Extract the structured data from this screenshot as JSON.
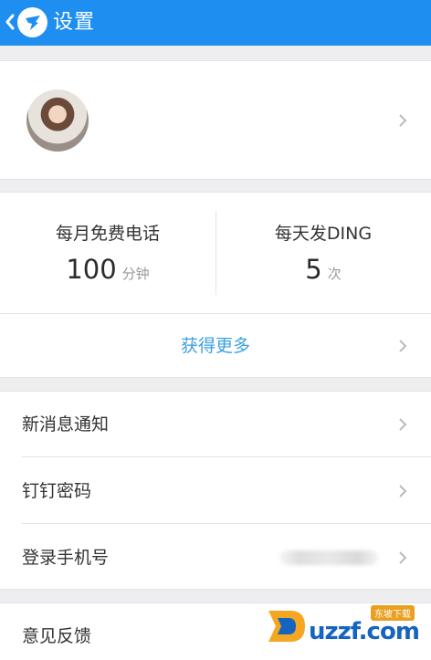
{
  "header": {
    "title": "设置"
  },
  "stats": {
    "calls": {
      "label": "每月免费电话",
      "value": "100",
      "unit": "分钟"
    },
    "ding": {
      "label": "每天发DING",
      "value": "5",
      "unit": "次"
    },
    "more_label": "获得更多"
  },
  "settings": {
    "items": [
      {
        "label": "新消息通知"
      },
      {
        "label": "钉钉密码"
      },
      {
        "label": "登录手机号"
      }
    ],
    "feedback_label": "意见反馈"
  },
  "watermark": {
    "text": "uzzf.com",
    "badge": "东坡下载"
  },
  "colors": {
    "header_bg": "#1e8ef0",
    "accent_link": "#3aa0e0",
    "page_bg": "#eeeef0"
  }
}
